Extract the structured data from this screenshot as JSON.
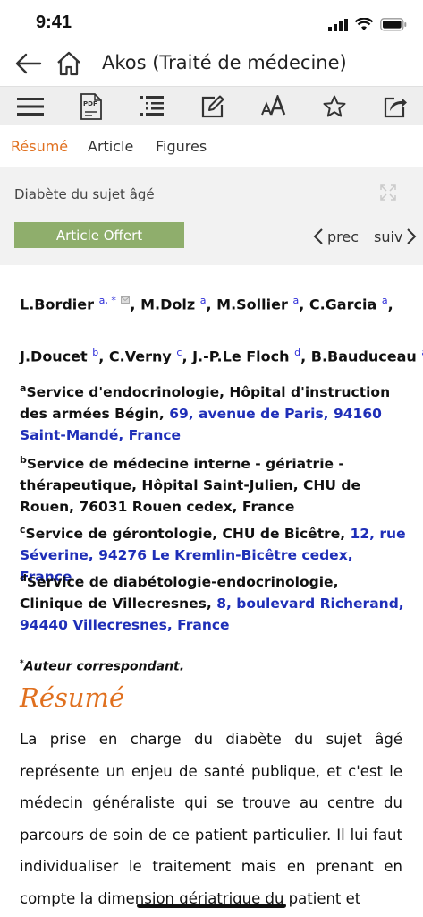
{
  "status": {
    "time": "9:41"
  },
  "header": {
    "title": "Akos (Traité de médecine)"
  },
  "toolbar": {
    "icons": [
      "menu-icon",
      "pdf-icon",
      "outline-icon",
      "note-icon",
      "font-size-icon",
      "star-icon",
      "share-icon"
    ],
    "pdf_label": "PDF"
  },
  "tabs": [
    {
      "label": "Résumé",
      "active": true
    },
    {
      "label": "Article",
      "active": false
    },
    {
      "label": "Figures",
      "active": false
    }
  ],
  "article": {
    "section_title": "Diabète du sujet âgé",
    "offer_button": "Article Offert",
    "prev_label": "prec",
    "next_label": "suiv"
  },
  "authors": {
    "line1": [
      {
        "name": "L.Bordier",
        "sup": "a, *"
      },
      {
        "name": "M.Dolz",
        "sup": "a"
      },
      {
        "name": "M.Sollier",
        "sup": "a"
      },
      {
        "name": "C.Garcia",
        "sup": "a"
      }
    ],
    "line2": [
      {
        "name": "J.Doucet",
        "sup": "b"
      },
      {
        "name": "C.Verny",
        "sup": "c"
      },
      {
        "name": "J.-P.Le Floch",
        "sup": "d"
      },
      {
        "name": "B.Bauduceau",
        "sup": "a"
      }
    ]
  },
  "affiliations": [
    {
      "letter": "a",
      "text": "Service d'endocrinologie, Hôpital d'instruction des armées Bégin, ",
      "address": "69, avenue de Paris, 94160 Saint-Mandé, France",
      "rest": ""
    },
    {
      "letter": "b",
      "text": "Service de médecine interne - gériatrie - thérapeutique, Hôpital Saint-Julien, CHU de Rouen, 76031 Rouen cedex, France",
      "address": "",
      "rest": ""
    },
    {
      "letter": "c",
      "text": "Service de gérontologie, CHU de Bicêtre, ",
      "address": "12, rue Séverine, 94276 Le Kremlin-Bicêtre cedex, France",
      "rest": ""
    },
    {
      "letter": "d",
      "text": "Service de diabétologie-endocrinologie, Clinique de Villecresnes, ",
      "address": "8, boulevard Richerand, 94440 Villecresnes, France",
      "rest": ""
    }
  ],
  "corresponding": {
    "mark": "*",
    "text": "Auteur correspondant."
  },
  "abstract": {
    "heading": "Résumé",
    "text": "La prise en charge du diabète du sujet âgé représente un enjeu de santé publique, et c'est le médecin généraliste qui se trouve au centre du parcours de soin de ce patient particulier. Il lui faut individualiser le traitement mais en prenant en compte la dimension gériatrique du patient et"
  },
  "colors": {
    "accent": "#e0701f",
    "offer": "#8fae6c",
    "link": "#1f2fb8"
  }
}
